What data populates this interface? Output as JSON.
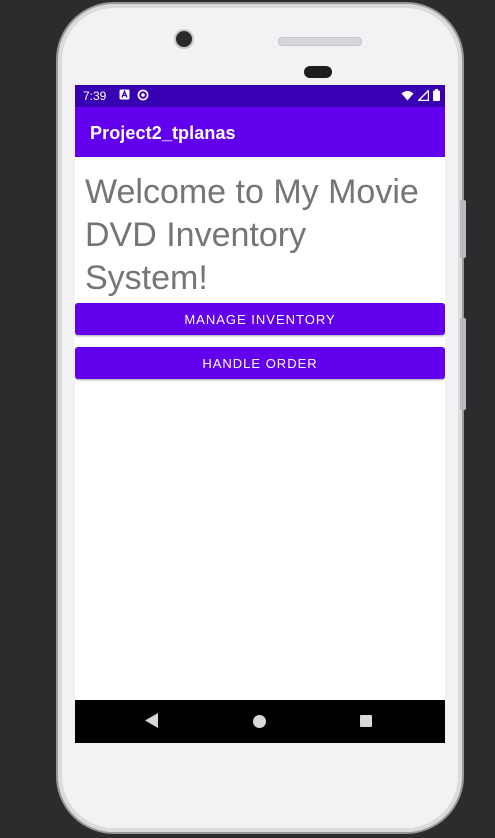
{
  "status_bar": {
    "time": "7:39",
    "left_icons": [
      "a-notification-icon",
      "sync-icon"
    ],
    "right_icons": [
      "wifi-icon",
      "signal-icon",
      "battery-icon"
    ],
    "color": "#3700b3"
  },
  "app_bar": {
    "title": "Project2_tplanas",
    "color": "#6200ee"
  },
  "main": {
    "welcome_text": "Welcome to My Movie DVD Inventory System!",
    "manage_inventory_label": "MANAGE INVENTORY",
    "handle_order_label": "HANDLE ORDER"
  },
  "nav_bar": {
    "icons": [
      "back-icon",
      "home-icon",
      "recents-icon"
    ]
  }
}
